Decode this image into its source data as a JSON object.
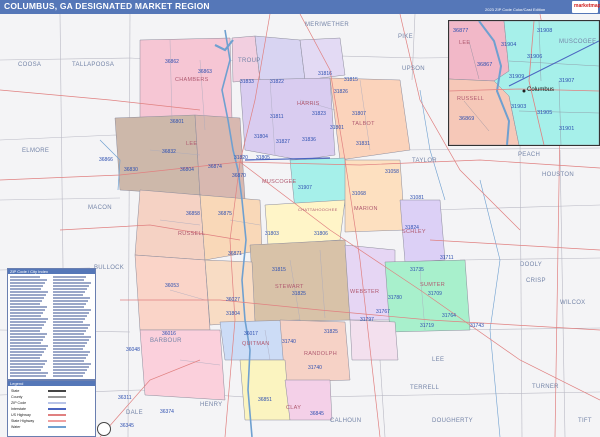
{
  "title": "COLUMBUS, GA DESIGNATED MARKET REGION",
  "edition": "2023 ZIP Code Color/Cast Edition",
  "logo_text": "marketmaps",
  "colors": {
    "title_bar": "#5577b8",
    "background": "#f4f4f6",
    "roads": "#e08080",
    "water": "#6fa0d0",
    "zip_label": "#2d4fb0",
    "county_label": "#7585a8"
  },
  "counties": [
    "COOSA",
    "TALLAPOOSA",
    "CHAMBERS",
    "TROUP",
    "MERIWETHER",
    "PIKE",
    "ELMORE",
    "LEE",
    "HARRIS",
    "TALBOT",
    "UPSON",
    "TAYLOR",
    "PEACH",
    "HOUSTON",
    "MACON",
    "MUSCOGEE",
    "CHATTAHOOCHEE",
    "MARION",
    "SCHLEY",
    "RUSSELL",
    "BULLOCK",
    "STEWART",
    "WEBSTER",
    "SUMTER",
    "DOOLY",
    "CRISP",
    "WILCOX",
    "BARBOUR",
    "QUITMAN",
    "RANDOLPH",
    "LEE",
    "TURNER",
    "TERRELL",
    "HENRY",
    "CLAY",
    "CALHOUN",
    "DOUGHERTY",
    "DALE",
    "TIFT"
  ],
  "zips": [
    "36862",
    "36863",
    "31833",
    "31822",
    "31816",
    "31815",
    "31826",
    "31811",
    "31823",
    "31801",
    "31836",
    "31807",
    "36801",
    "36832",
    "31804",
    "31827",
    "36866",
    "36830",
    "31831",
    "36874",
    "36804",
    "31820",
    "31805",
    "31907",
    "36870",
    "36858",
    "36875",
    "31803",
    "31806",
    "31058",
    "31081",
    "31068",
    "36871",
    "31711",
    "31815",
    "31824",
    "31780",
    "31735",
    "31709",
    "36053",
    "36027",
    "31825",
    "31767",
    "31719",
    "31743",
    "31764",
    "31797",
    "36016",
    "31740",
    "36048",
    "36311",
    "31740",
    "36845",
    "36345",
    "36374",
    "36017",
    "36851",
    "31825",
    "31804"
  ],
  "inset": {
    "counties": [
      "LEE",
      "MUSCOGEE",
      "RUSSELL"
    ],
    "zips": [
      "36877",
      "31908",
      "31904",
      "31906",
      "36867",
      "31907",
      "31909",
      "31903",
      "31905",
      "36869",
      "31901"
    ],
    "city": "Columbus"
  },
  "zip_table": {
    "header": "ZIP Code / City Index"
  },
  "legend": {
    "header": "Legend",
    "items": [
      "State",
      "County",
      "ZIP Code",
      "Interstate",
      "US Highway",
      "State Highway",
      "Water"
    ]
  }
}
